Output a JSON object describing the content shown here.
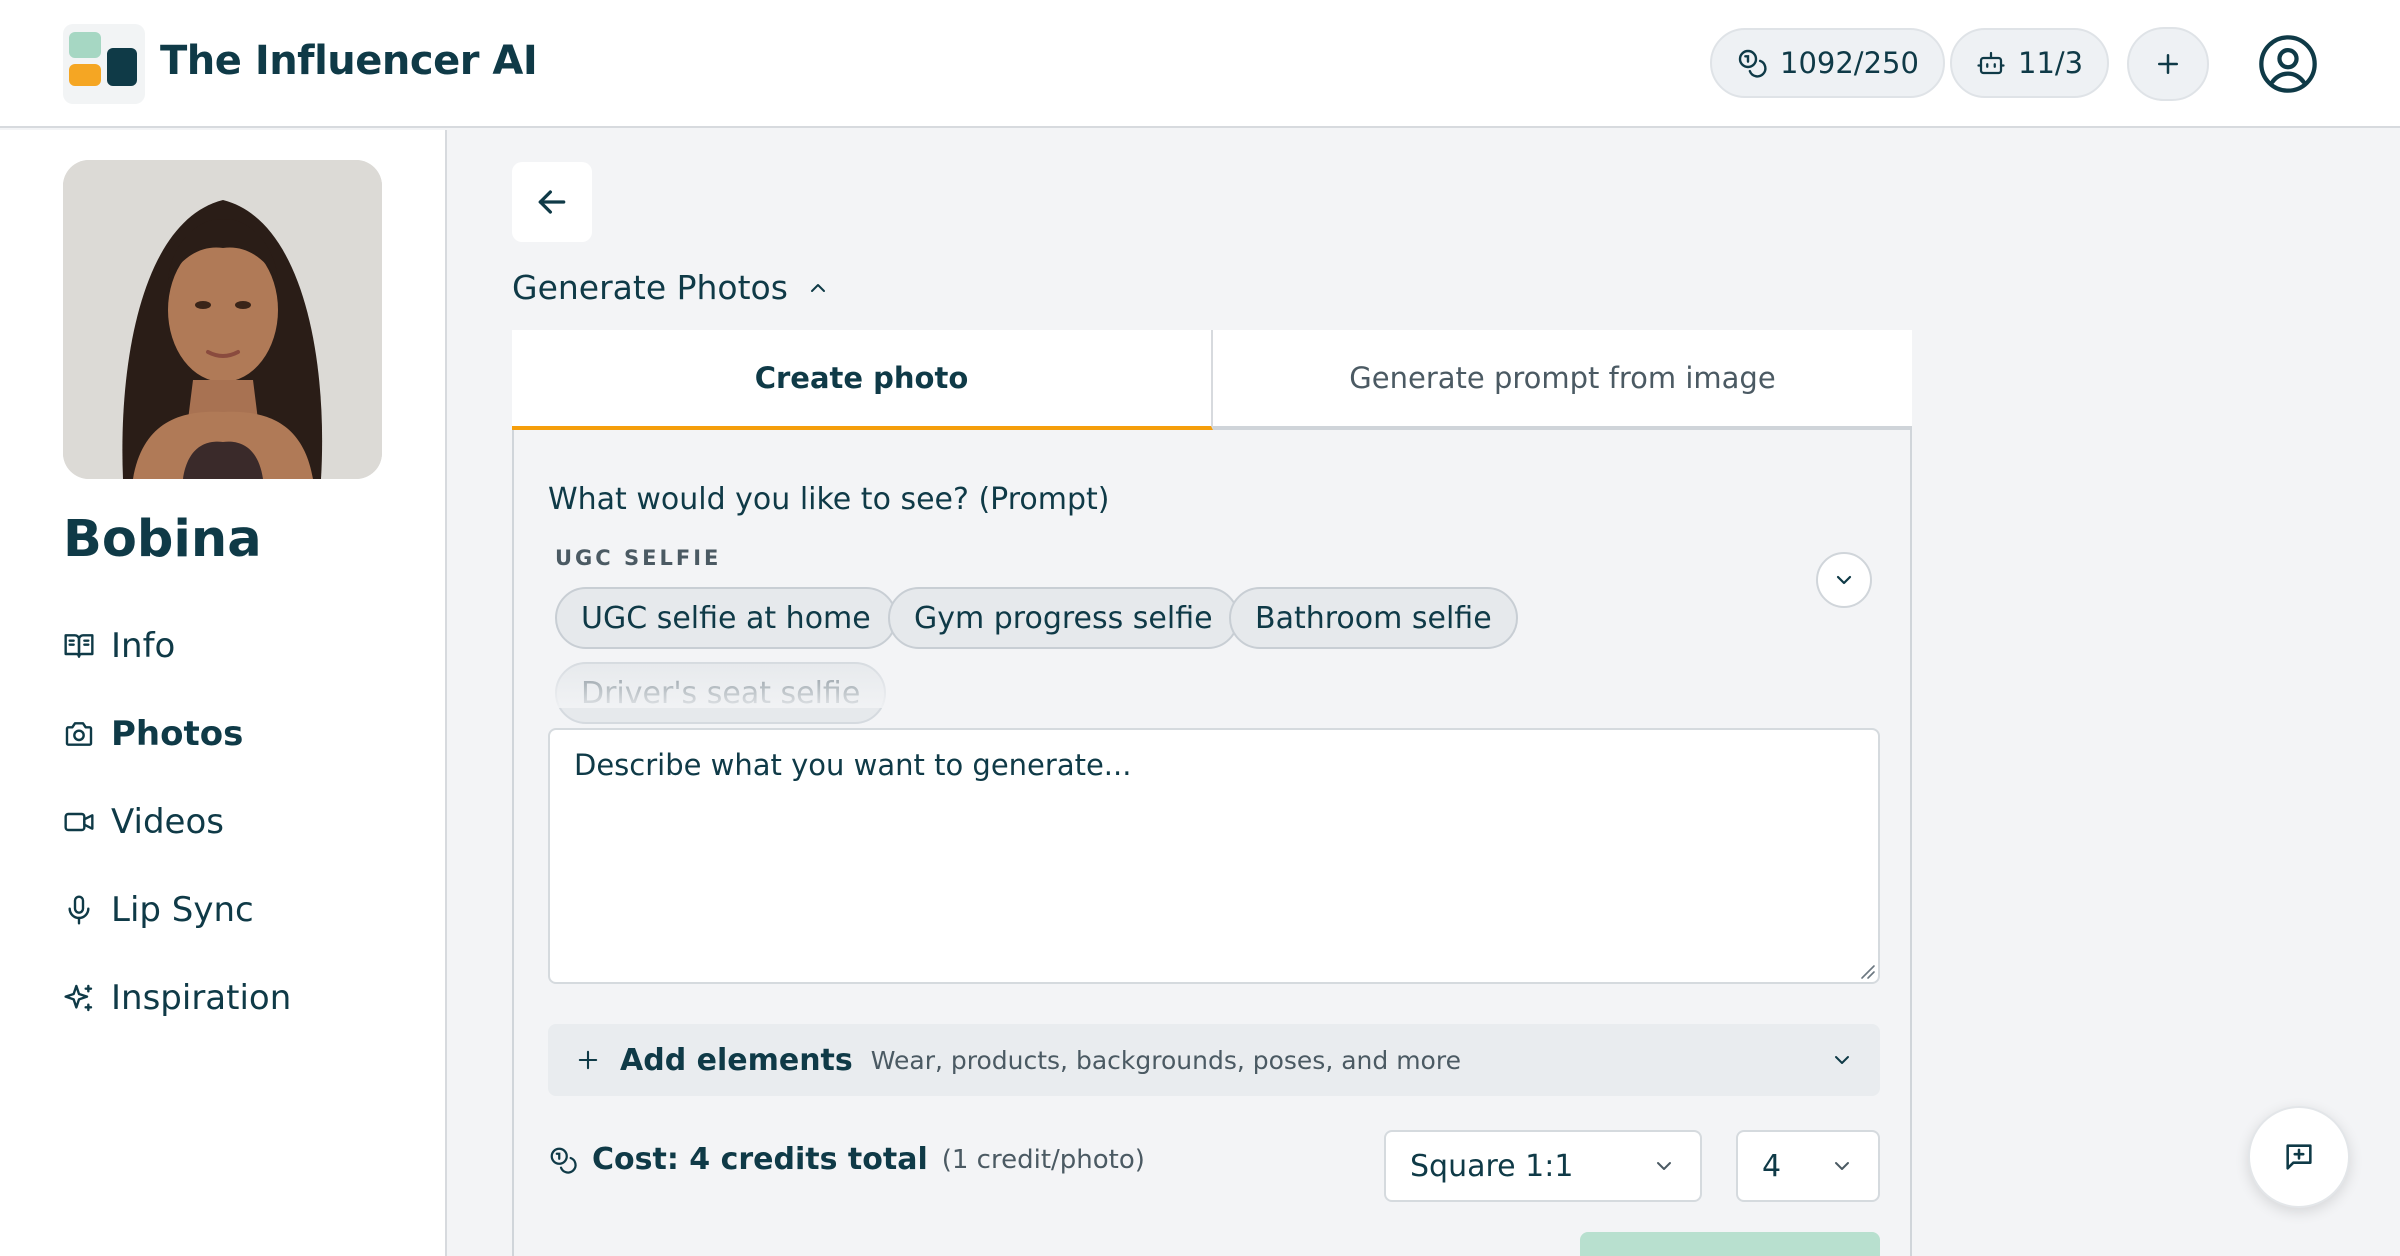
{
  "header": {
    "brand": "The Influencer AI",
    "credits": "1092/250",
    "models": "11/3",
    "icons": [
      "coins-icon",
      "robot-icon",
      "plus-icon",
      "user-circle-icon"
    ]
  },
  "sidebar": {
    "name": "Bobina",
    "items": [
      {
        "label": "Info",
        "icon": "book-open-icon"
      },
      {
        "label": "Photos",
        "icon": "camera-icon",
        "active": true
      },
      {
        "label": "Videos",
        "icon": "video-icon"
      },
      {
        "label": "Lip Sync",
        "icon": "microphone-icon"
      },
      {
        "label": "Inspiration",
        "icon": "sparkles-icon"
      }
    ]
  },
  "main": {
    "section_title": "Generate Photos",
    "tabs": [
      {
        "label": "Create photo",
        "active": true
      },
      {
        "label": "Generate prompt from image"
      }
    ],
    "prompt_label": "What would you like to see? (Prompt)",
    "group_label": "UGC SELFIE",
    "chips": [
      "UGC selfie at home",
      "Gym progress selfie",
      "Bathroom selfie",
      "Driver's seat selfie"
    ],
    "textarea_placeholder": "Describe what you want to generate...",
    "add_elements": {
      "title": "Add elements",
      "subtitle": "Wear, products, backgrounds, poses, and more"
    },
    "cost": {
      "main": "Cost: 4 credits total",
      "sub": "(1 credit/photo)"
    },
    "aspect_select": "Square 1:1",
    "count_select": "4"
  },
  "colors": {
    "accent": "#f59e0b",
    "brand_dark": "#0f3a47",
    "generate_button": "#b8e0cf"
  }
}
